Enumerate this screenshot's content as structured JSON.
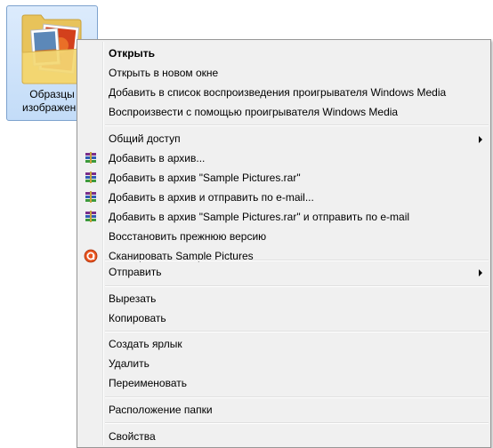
{
  "folder": {
    "label_line1": "Образцы",
    "label_line2": "изображени"
  },
  "menu": {
    "items": [
      {
        "label": "Открыть"
      },
      {
        "label": "Открыть в новом окне"
      },
      {
        "label": "Добавить в список воспроизведения проигрывателя Windows Media"
      },
      {
        "label": "Воспроизвести с помощью проигрывателя Windows Media"
      },
      {
        "label": "Общий доступ"
      },
      {
        "label": "Добавить в архив..."
      },
      {
        "label": "Добавить в архив \"Sample Pictures.rar\""
      },
      {
        "label": "Добавить в архив и отправить по e-mail..."
      },
      {
        "label": "Добавить в архив \"Sample Pictures.rar\" и отправить по e-mail"
      },
      {
        "label": "Восстановить прежнюю версию"
      },
      {
        "label": "Сканировать Sample Pictures"
      },
      {
        "label": "Отправить"
      },
      {
        "label": "Вырезать"
      },
      {
        "label": "Копировать"
      },
      {
        "label": "Создать ярлык"
      },
      {
        "label": "Удалить"
      },
      {
        "label": "Переименовать"
      },
      {
        "label": "Расположение папки"
      },
      {
        "label": "Свойства"
      }
    ]
  },
  "colors": {
    "menu_bg": "#f0f0f0",
    "menu_border": "#979797",
    "selection_bg": "#cce4fa",
    "folder_yellow": "#f2d46c"
  },
  "icons": {
    "archive": "winrar-books-icon",
    "scan": "antivirus-scan-icon",
    "submenu": "chevron-right-icon"
  }
}
